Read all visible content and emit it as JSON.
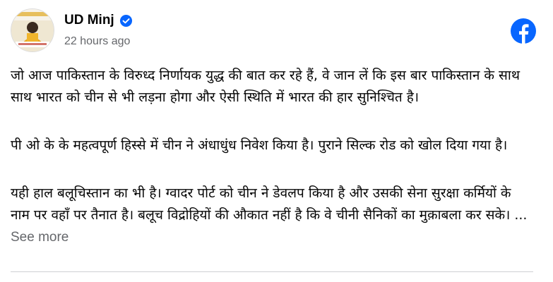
{
  "post": {
    "author": "UD Minj",
    "timestamp": "22 hours ago",
    "paragraphs": [
      "जो आज पाकिस्तान के विरुध्द निर्णायक युद्ध की बात कर रहे हैं, वे जान लें कि इस बार पाकिस्तान के साथ साथ भारत को चीन से भी लड़ना होगा और ऐसी स्थिति में भारत की हार सुनिश्चित है।",
      "पी ओ के के महत्वपूर्ण हिस्से में चीन ने अंधाधुंध निवेश किया है। पुराने सिल्क रोड को खोल दिया गया है।",
      "यही हाल बलूचिस्तान का भी है। ग्वादर पोर्ट को चीन ने डेवलप किया है और उसकी सेना सुरक्षा कर्मियों के नाम पर वहाँ पर तैनात है। बलूच विद्रोहियों की औकात नहीं है कि वे चीनी सैनिकों का मुक़ाबला कर सके।"
    ],
    "ellipsis": "...",
    "see_more": "See more"
  },
  "icons": {
    "verified": "verified-badge-icon",
    "platform": "facebook-logo-icon"
  },
  "colors": {
    "facebook_blue": "#0866ff",
    "secondary_text": "#65676b",
    "divider": "#ced0d4"
  }
}
